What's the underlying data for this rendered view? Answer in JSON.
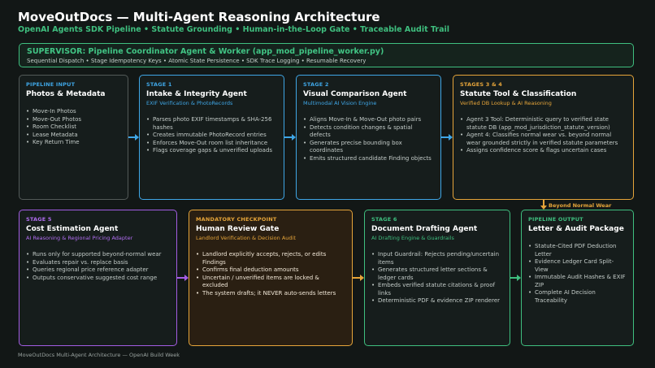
{
  "header": {
    "title": "MoveOutDocs — Multi-Agent Reasoning Architecture",
    "subtitle": "OpenAI Agents SDK Pipeline  •  Statute Grounding  •  Human-in-the-Loop Gate  •  Traceable Audit Trail"
  },
  "supervisor": {
    "title": "SUPERVISOR: Pipeline Coordinator Agent & Worker (app_mod_pipeline_worker.py)",
    "subtitle": "Sequential Dispatch  •  Stage Idempotency Keys  •  Atomic State Persistence  •  SDK Trace Logging  •  Resumable Recovery"
  },
  "boxes": {
    "input": {
      "stage": "PIPELINE INPUT",
      "title": "Photos & Metadata",
      "sub": "",
      "items": [
        "Move-In Photos",
        "Move-Out Photos",
        "Room Checklist",
        "Lease Metadata",
        "Key Return Time"
      ]
    },
    "stage1": {
      "stage": "STAGE 1",
      "title": "Intake & Integrity Agent",
      "sub": "EXIF Verification & PhotoRecords",
      "items": [
        "Parses photo EXIF timestamps & SHA-256 hashes",
        "Creates immutable PhotoRecord entries",
        "Enforces Move-Out room list inheritance",
        "Flags coverage gaps & unverified uploads"
      ]
    },
    "stage2": {
      "stage": "STAGE 2",
      "title": "Visual Comparison Agent",
      "sub": "Multimodal AI Vision Engine",
      "items": [
        "Aligns Move-In & Move-Out photo pairs",
        "Detects condition changes & spatial defects",
        "Generates precise bounding box coordinates",
        "Emits structured candidate Finding objects"
      ]
    },
    "stage34": {
      "stage": "STAGES 3 & 4",
      "title": "Statute Tool & Classification",
      "sub": "Verified DB Lookup & AI Reasoning",
      "items": [
        "Agent 3 Tool: Deterministic query to verified state statute DB (app_mod_jurisdiction_statute_version)",
        "Agent 4: Classifies normal wear vs. beyond normal wear grounded strictly in verified statute parameters",
        "Assigns confidence score & flags uncertain cases"
      ]
    },
    "stage5": {
      "stage": "STAGE 5",
      "title": "Cost Estimation Agent",
      "sub": "AI Reasoning & Regional Pricing Adapter",
      "items": [
        "Runs only for supported beyond-normal wear",
        "Evaluates repair vs. replace basis",
        "Queries regional price reference adapter",
        "Outputs conservative suggested cost range"
      ]
    },
    "review": {
      "stage": "MANDATORY CHECKPOINT",
      "title": "Human Review Gate",
      "sub": "Landlord Verification & Decision Audit",
      "items": [
        "Landlord explicitly accepts, rejects, or edits Findings",
        "Confirms final deduction amounts",
        "Uncertain / unverified items are locked & excluded",
        "The system drafts; it NEVER auto-sends letters"
      ]
    },
    "stage6": {
      "stage": "STAGE 6",
      "title": "Document Drafting Agent",
      "sub": "AI Drafting Engine & Guardrails",
      "items": [
        "Input Guardrail: Rejects pending/uncertain items",
        "Generates structured letter sections & ledger cards",
        "Embeds verified statute citations & proof links",
        "Deterministic PDF & evidence ZIP renderer"
      ]
    },
    "output": {
      "stage": "PIPELINE OUTPUT",
      "title": "Letter & Audit Package",
      "sub": "",
      "items": [
        "Statute-Cited PDF Deduction Letter",
        "Evidence Ledger Card Split-View",
        "Immutable Audit Hashes & EXIF ZIP",
        "Complete AI Decision Traceability"
      ]
    }
  },
  "connector_label": "Beyond Normal Wear",
  "footer": "MoveOutDocs Multi-Agent Architecture — OpenAI Build Week",
  "colors": {
    "blue": "#3fa6e6",
    "orange": "#e6a53a",
    "purple": "#a35de3",
    "green": "#3fbf7f",
    "gray": "#535a58"
  }
}
